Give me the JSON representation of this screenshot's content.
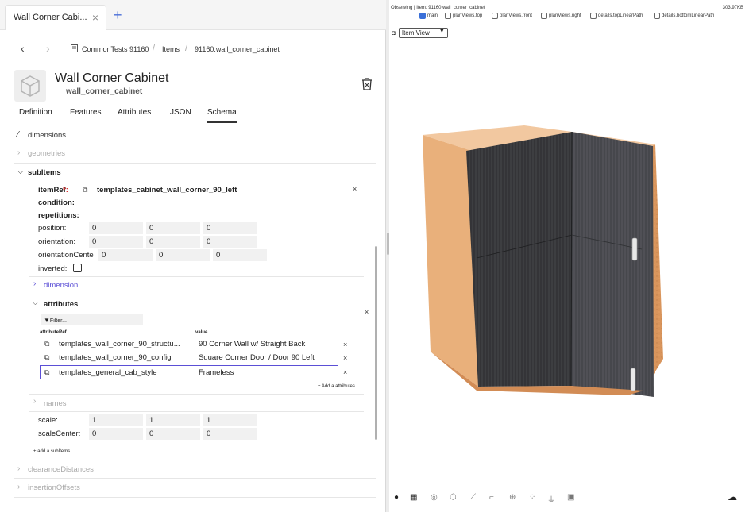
{
  "tab": {
    "title": "Wall Corner Cabi...",
    "close_glyph": "×",
    "add_glyph": "+"
  },
  "breadcrumb": {
    "back": "‹",
    "forward": "›",
    "root": "CommonTests 91160",
    "items": "Items",
    "current": "91160.wall_corner_cabinet",
    "sep": "/"
  },
  "header": {
    "title": "Wall Corner Cabinet",
    "subtitle": "wall_corner_cabinet"
  },
  "tabs": {
    "definition": "Definition",
    "features": "Features",
    "attributes": "Attributes",
    "json": "JSON",
    "schema": "Schema"
  },
  "schema": {
    "dimensions": "dimensions",
    "geometries": "geometries",
    "subitems": "subItems",
    "item_ref_label": "itemRef",
    "required_mark": "*:",
    "item_ref_value": "templates_cabinet_wall_corner_90_left",
    "condition": "condition:",
    "repetitions": "repetitions:",
    "position_label": "position:",
    "position": [
      "0",
      "0",
      "0"
    ],
    "orientation_label": "orientation:",
    "orientation": [
      "0",
      "0",
      "0"
    ],
    "orientation_center_label": "orientationCente",
    "orientation_center": [
      "0",
      "0",
      "0"
    ],
    "inverted_label": "inverted:",
    "dimension": "dimension",
    "attributes": "attributes",
    "filter_placeholder": "Filter...",
    "col_ref": "attributeRef",
    "col_value": "value",
    "attr_rows": [
      {
        "ref": "templates_wall_corner_90_structu...",
        "value": "90 Corner Wall w/ Straight Back"
      },
      {
        "ref": "templates_wall_corner_90_config",
        "value": "Square Corner Door / Door 90 Left"
      },
      {
        "ref": "templates_general_cab_style",
        "value": "Frameless"
      }
    ],
    "add_attribute": "+ Add a attributes",
    "names": "names",
    "scale_label": "scale:",
    "scale": [
      "1",
      "1",
      "1"
    ],
    "scale_center_label": "scaleCenter:",
    "scale_center": [
      "0",
      "0",
      "0"
    ],
    "add_subitem": "+ add a subItems",
    "clearance": "clearanceDistances",
    "insertion": "insertionOffsets"
  },
  "viewer": {
    "observing": "Observing | Item: 91160.wall_corner_cabinet",
    "size": "303.97KB",
    "checks": [
      {
        "label": "main",
        "on": true
      },
      {
        "label": "planViews.top",
        "on": false
      },
      {
        "label": "planViews.front",
        "on": false
      },
      {
        "label": "planViews.right",
        "on": false
      },
      {
        "label": "details.topLinearPath",
        "on": false
      },
      {
        "label": "details.bottomLinearPath",
        "on": false
      }
    ],
    "view_mode": "Item View"
  },
  "colors": {
    "accent": "#3a6fd8",
    "link": "#5b4fd6",
    "wood": "#e0a26a",
    "door": "#3a3a3c"
  }
}
